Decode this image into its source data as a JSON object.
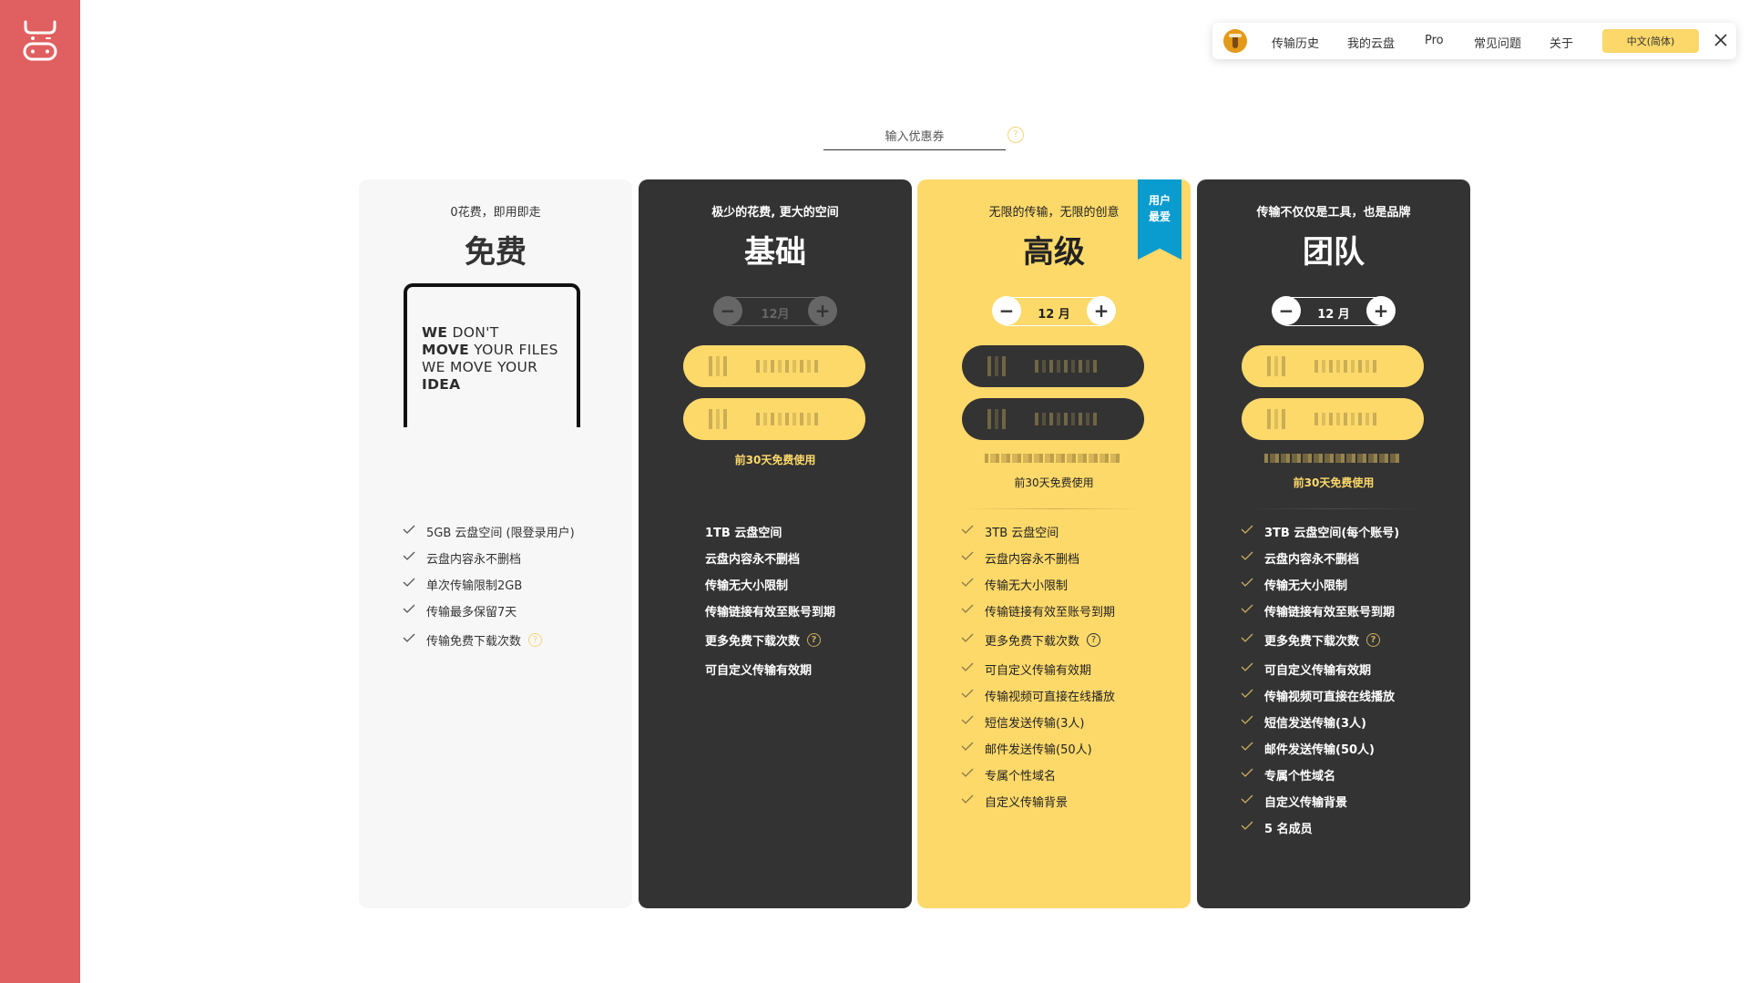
{
  "colors": {
    "sidebar": "#e05f60",
    "accent_yellow": "#fdd96a",
    "dark_card": "#333333",
    "light_card": "#f7f7f7",
    "ribbon": "#0a9bcf"
  },
  "sidebar": {
    "logo_icon": "cow-face-icon"
  },
  "nav": {
    "avatar_icon": "user-avatar-icon",
    "items": [
      {
        "label": "传输历史"
      },
      {
        "label": "我的云盘"
      },
      {
        "label": "Pro"
      },
      {
        "label": "常见问题"
      },
      {
        "label": "关于"
      }
    ],
    "language": "中文(简体)",
    "close_icon": "close-icon"
  },
  "coupon": {
    "placeholder": "输入优惠券",
    "value": "",
    "help": "?"
  },
  "plans": [
    {
      "id": "free",
      "tagline": "0花费，即用即走",
      "name": "免费",
      "slogan": [
        {
          "bold": "WE",
          "rest": " DON'T"
        },
        {
          "bold": "MOVE",
          "rest": " YOUR FILES"
        },
        {
          "bold": "",
          "rest": "WE MOVE YOUR"
        },
        {
          "bold": "IDEA",
          "rest": ""
        }
      ],
      "features": [
        {
          "text": "5GB 云盘空间 (限登录用户)"
        },
        {
          "text": "云盘内容永不删档"
        },
        {
          "text": "单次传输限制2GB"
        },
        {
          "text": "传输最多保留7天"
        },
        {
          "text": "传输免费下载次数",
          "help": "?"
        }
      ]
    },
    {
      "id": "basic",
      "tagline": "极少的花费, 更大的空间",
      "name": "基础",
      "duration": "12月",
      "minus": "−",
      "plus": "+",
      "buttons_obscured": true,
      "trial": "前30天免费使用",
      "features": [
        {
          "text": "1TB 云盘空间"
        },
        {
          "text": "云盘内容永不删档"
        },
        {
          "text": "传输无大小限制"
        },
        {
          "text": "传输链接有效至账号到期"
        },
        {
          "text": "更多免费下载次数",
          "help": "?"
        },
        {
          "text": "可自定义传输有效期"
        }
      ]
    },
    {
      "id": "premium",
      "tagline": "无限的传输，无限的创意",
      "name": "高级",
      "ribbon": [
        "用户",
        "最爱"
      ],
      "duration": "12 月",
      "minus": "−",
      "plus": "+",
      "buttons_obscured": true,
      "trial": "前30天免费使用",
      "features": [
        {
          "text": "3TB 云盘空间"
        },
        {
          "text": "云盘内容永不删档"
        },
        {
          "text": "传输无大小限制"
        },
        {
          "text": "传输链接有效至账号到期"
        },
        {
          "text": "更多免费下载次数",
          "help": "?"
        },
        {
          "text": "可自定义传输有效期"
        },
        {
          "text": "传输视频可直接在线播放"
        },
        {
          "text": "短信发送传输(3人)"
        },
        {
          "text": "邮件发送传输(50人)"
        },
        {
          "text": "专属个性域名"
        },
        {
          "text": "自定义传输背景"
        }
      ]
    },
    {
      "id": "team",
      "tagline": "传输不仅仅是工具，也是品牌",
      "name": "团队",
      "duration": "12 月",
      "minus": "−",
      "plus": "+",
      "buttons_obscured": true,
      "trial": "前30天免费使用",
      "features": [
        {
          "text": "3TB 云盘空间(每个账号)"
        },
        {
          "text": "云盘内容永不删档"
        },
        {
          "text": "传输无大小限制"
        },
        {
          "text": "传输链接有效至账号到期"
        },
        {
          "text": "更多免费下载次数",
          "help": "?"
        },
        {
          "text": "可自定义传输有效期"
        },
        {
          "text": "传输视频可直接在线播放"
        },
        {
          "text": "短信发送传输(3人)"
        },
        {
          "text": "邮件发送传输(50人)"
        },
        {
          "text": "专属个性域名"
        },
        {
          "text": "自定义传输背景"
        },
        {
          "text": "5 名成员"
        }
      ]
    }
  ]
}
